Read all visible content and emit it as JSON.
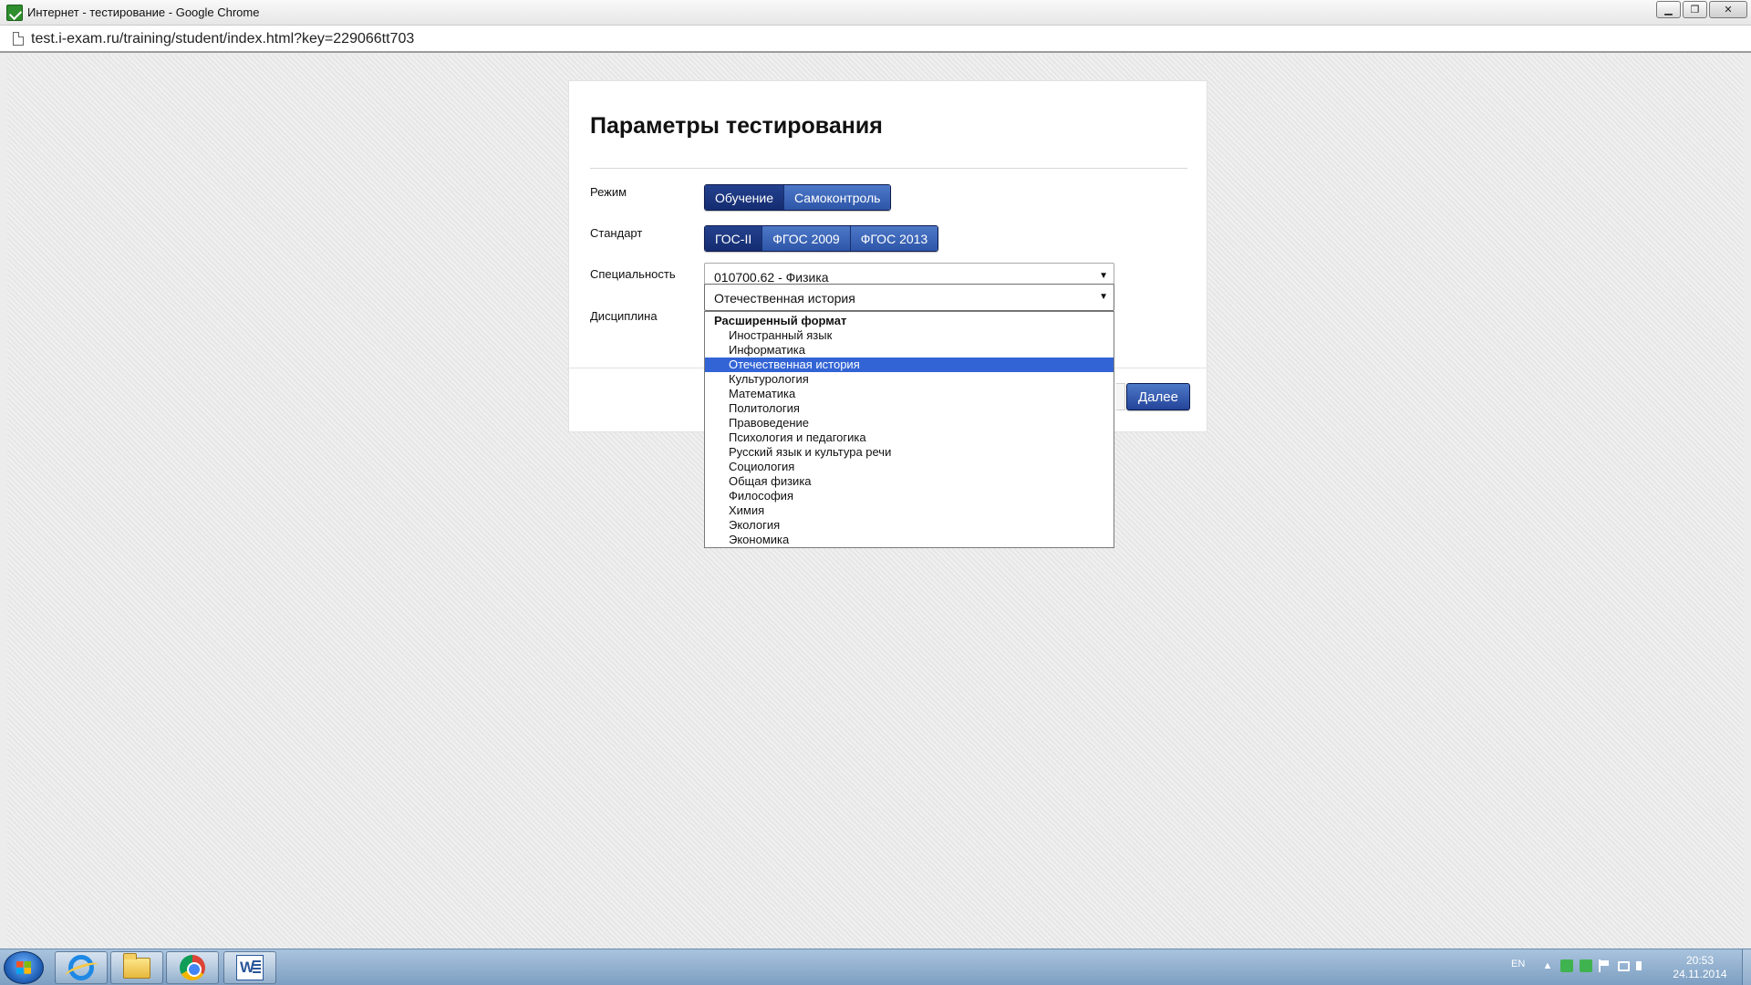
{
  "window": {
    "title": "Интернет - тестирование - Google Chrome",
    "minimize_icon": "minimize-icon",
    "maximize_icon": "maximize-icon",
    "close_icon": "close-icon"
  },
  "address_bar": {
    "url": "test.i-exam.ru/training/student/index.html?key=229066tt703"
  },
  "form": {
    "title": "Параметры тестирования",
    "mode": {
      "label": "Режим",
      "options": [
        "Обучение",
        "Самоконтроль"
      ],
      "selected": "Обучение"
    },
    "standard": {
      "label": "Стандарт",
      "options": [
        "ГОС-II",
        "ФГОС 2009",
        "ФГОС 2013"
      ],
      "selected": "ГОС-II"
    },
    "specialty": {
      "label": "Специальность",
      "value": "010700.62 - Физика"
    },
    "discipline": {
      "label": "Дисциплина",
      "value": "Отечественная история",
      "group_label": "Расширенный формат",
      "options": [
        "Иностранный язык",
        "Информатика",
        "Отечественная история",
        "Культурология",
        "Математика",
        "Политология",
        "Правоведение",
        "Психология и педагогика",
        "Русский язык и культура речи",
        "Социология",
        "Общая физика",
        "Философия",
        "Химия",
        "Экология",
        "Экономика"
      ],
      "highlighted_index": 2
    },
    "next_button": "Далее"
  },
  "taskbar": {
    "apps": [
      "internet-explorer-icon",
      "file-explorer-icon",
      "chrome-icon",
      "word-icon"
    ],
    "language": "EN",
    "time": "20:53",
    "date": "24.11.2014"
  },
  "colors": {
    "button_blue": "#2e56a8",
    "button_active": "#142c70",
    "selection_blue": "#3264d6",
    "taskbar": "#8eaed0"
  }
}
